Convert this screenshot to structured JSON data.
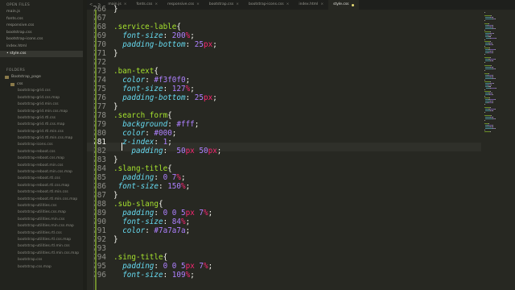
{
  "sidebar": {
    "open_files_heading": "OPEN FILES",
    "open_files": [
      "main.js",
      "fonts.css",
      "responsive.css",
      "bootstrap.css",
      "bootstrap-icons.css",
      "index.html",
      "• style.css"
    ],
    "folders_heading": "FOLDERS",
    "root_folder": "Bootstrap_page",
    "sub_folder": "css",
    "css_files": [
      "bootstrap-grid.css",
      "bootstrap-grid.css.map",
      "bootstrap-grid.min.css",
      "bootstrap-grid.min.css.map",
      "bootstrap-grid.rtl.css",
      "bootstrap-grid.rtl.css.map",
      "bootstrap-grid.rtl.min.css",
      "bootstrap-grid.rtl.min.css.map",
      "bootstrap-icons.css",
      "bootstrap-reboot.css",
      "bootstrap-reboot.css.map",
      "bootstrap-reboot.min.css",
      "bootstrap-reboot.min.css.map",
      "bootstrap-reboot.rtl.css",
      "bootstrap-reboot.rtl.css.map",
      "bootstrap-reboot.rtl.min.css",
      "bootstrap-reboot.rtl.min.css.map",
      "bootstrap-utilities.css",
      "bootstrap-utilities.css.map",
      "bootstrap-utilities.min.css",
      "bootstrap-utilities.min.css.map",
      "bootstrap-utilities.rtl.css",
      "bootstrap-utilities.rtl.css.map",
      "bootstrap-utilities.rtl.min.css",
      "bootstrap-utilities.rtl.min.css.map",
      "bootstrap.css",
      "bootstrap.css.map"
    ]
  },
  "tabs": [
    "main.js",
    "fonts.css",
    "responsive.css",
    "bootstrap.css",
    "bootstrap-icons.css",
    "index.html",
    "style.css"
  ],
  "nav": {
    "back": "<",
    "forward": ">"
  },
  "editor": {
    "current_line": 281,
    "lines": [
      {
        "n": "266",
        "t": [
          [
            "brace",
            "}"
          ]
        ]
      },
      {
        "n": "267",
        "t": []
      },
      {
        "n": "268",
        "t": [
          [
            "sel",
            ".service-lable"
          ],
          [
            "brace",
            "{"
          ]
        ]
      },
      {
        "n": "269",
        "t": [
          [
            "pun",
            "  "
          ],
          [
            "prop",
            "font-size"
          ],
          [
            "pun",
            ": "
          ],
          [
            "val",
            "200"
          ],
          [
            "unit",
            "%"
          ],
          [
            "pun",
            ";"
          ]
        ]
      },
      {
        "n": "270",
        "t": [
          [
            "pun",
            "  "
          ],
          [
            "prop",
            "padding-bottom"
          ],
          [
            "pun",
            ": "
          ],
          [
            "val",
            "25"
          ],
          [
            "unit",
            "px"
          ],
          [
            "pun",
            ";"
          ]
        ]
      },
      {
        "n": "271",
        "t": [
          [
            "brace",
            "}"
          ]
        ]
      },
      {
        "n": "272",
        "t": []
      },
      {
        "n": "273",
        "t": [
          [
            "sel",
            ".ban-text"
          ],
          [
            "brace",
            "{"
          ]
        ]
      },
      {
        "n": "274",
        "t": [
          [
            "pun",
            "  "
          ],
          [
            "prop",
            "color"
          ],
          [
            "pun",
            ": "
          ],
          [
            "val",
            "#f3f0f0"
          ],
          [
            "pun",
            ";"
          ]
        ]
      },
      {
        "n": "275",
        "t": [
          [
            "pun",
            "  "
          ],
          [
            "prop",
            "font-size"
          ],
          [
            "pun",
            ": "
          ],
          [
            "val",
            "127"
          ],
          [
            "unit",
            "%"
          ],
          [
            "pun",
            ";"
          ]
        ]
      },
      {
        "n": "276",
        "t": [
          [
            "pun",
            "  "
          ],
          [
            "prop",
            "padding-bottom"
          ],
          [
            "pun",
            ": "
          ],
          [
            "val",
            "25"
          ],
          [
            "unit",
            "px"
          ],
          [
            "pun",
            ";"
          ]
        ]
      },
      {
        "n": "277",
        "t": [
          [
            "brace",
            "}"
          ]
        ]
      },
      {
        "n": "278",
        "t": [
          [
            "sel",
            ".search_form"
          ],
          [
            "brace",
            "{"
          ]
        ]
      },
      {
        "n": "279",
        "t": [
          [
            "pun",
            "  "
          ],
          [
            "prop",
            "background"
          ],
          [
            "pun",
            ": "
          ],
          [
            "val",
            "#fff"
          ],
          [
            "pun",
            ";"
          ]
        ]
      },
      {
        "n": "280",
        "t": [
          [
            "pun",
            "  "
          ],
          [
            "prop",
            "color"
          ],
          [
            "pun",
            ": "
          ],
          [
            "val",
            "#000"
          ],
          [
            "pun",
            ";"
          ]
        ]
      },
      {
        "n": "281",
        "t": [
          [
            "pun",
            "  "
          ],
          [
            "prop",
            "z-index"
          ],
          [
            "pun",
            ": "
          ],
          [
            "val",
            "1"
          ],
          [
            "pun",
            ";"
          ]
        ]
      },
      {
        "n": "282",
        "t": [
          [
            "pun",
            "    "
          ],
          [
            "prop",
            "padding"
          ],
          [
            "pun",
            ":  "
          ],
          [
            "val",
            "50"
          ],
          [
            "unit",
            "px"
          ],
          [
            "pun",
            " "
          ],
          [
            "val",
            "50"
          ],
          [
            "unit",
            "px"
          ],
          [
            "pun",
            ";"
          ]
        ]
      },
      {
        "n": "283",
        "t": [
          [
            "brace",
            "}"
          ]
        ]
      },
      {
        "n": "284",
        "t": [
          [
            "sel",
            ".slang-title"
          ],
          [
            "brace",
            "{"
          ]
        ]
      },
      {
        "n": "285",
        "t": [
          [
            "pun",
            "  "
          ],
          [
            "prop",
            "padding"
          ],
          [
            "pun",
            ": "
          ],
          [
            "val",
            "0 7"
          ],
          [
            "unit",
            "%"
          ],
          [
            "pun",
            ";"
          ]
        ]
      },
      {
        "n": "286",
        "t": [
          [
            "pun",
            " "
          ],
          [
            "prop",
            "font-size"
          ],
          [
            "pun",
            ": "
          ],
          [
            "val",
            "150"
          ],
          [
            "unit",
            "%"
          ],
          [
            "pun",
            ";"
          ]
        ]
      },
      {
        "n": "287",
        "t": [
          [
            "brace",
            "}"
          ]
        ]
      },
      {
        "n": "288",
        "t": [
          [
            "sel",
            ".sub-slang"
          ],
          [
            "brace",
            "{"
          ]
        ]
      },
      {
        "n": "289",
        "t": [
          [
            "pun",
            "  "
          ],
          [
            "prop",
            "padding"
          ],
          [
            "pun",
            ": "
          ],
          [
            "val",
            "0 0 5"
          ],
          [
            "unit",
            "px"
          ],
          [
            "pun",
            " "
          ],
          [
            "val",
            "7"
          ],
          [
            "unit",
            "%"
          ],
          [
            "pun",
            ";"
          ]
        ]
      },
      {
        "n": "290",
        "t": [
          [
            "pun",
            "  "
          ],
          [
            "prop",
            "font-size"
          ],
          [
            "pun",
            ": "
          ],
          [
            "val",
            "84"
          ],
          [
            "unit",
            "%"
          ],
          [
            "pun",
            ";"
          ]
        ]
      },
      {
        "n": "291",
        "t": [
          [
            "pun",
            "  "
          ],
          [
            "prop",
            "color"
          ],
          [
            "pun",
            ": "
          ],
          [
            "val",
            "#7a7a7a"
          ],
          [
            "pun",
            ";"
          ]
        ]
      },
      {
        "n": "292",
        "t": [
          [
            "brace",
            "}"
          ]
        ]
      },
      {
        "n": "293",
        "t": []
      },
      {
        "n": "294",
        "t": [
          [
            "sel",
            ".sing-title"
          ],
          [
            "brace",
            "{"
          ]
        ]
      },
      {
        "n": "295",
        "t": [
          [
            "pun",
            "  "
          ],
          [
            "prop",
            "padding"
          ],
          [
            "pun",
            ": "
          ],
          [
            "val",
            "0 0 5"
          ],
          [
            "unit",
            "px"
          ],
          [
            "pun",
            " "
          ],
          [
            "val",
            "7"
          ],
          [
            "unit",
            "%"
          ],
          [
            "pun",
            ";"
          ]
        ]
      },
      {
        "n": "296",
        "t": [
          [
            "pun",
            "  "
          ],
          [
            "prop",
            "font-size"
          ],
          [
            "pun",
            ": "
          ],
          [
            "val",
            "109"
          ],
          [
            "unit",
            "%"
          ],
          [
            "pun",
            ";"
          ]
        ]
      }
    ]
  },
  "colors": {
    "background": "#272822",
    "selector": "#a6e22e",
    "property": "#66d9ef",
    "value": "#ae81ff",
    "unit": "#f92672"
  }
}
